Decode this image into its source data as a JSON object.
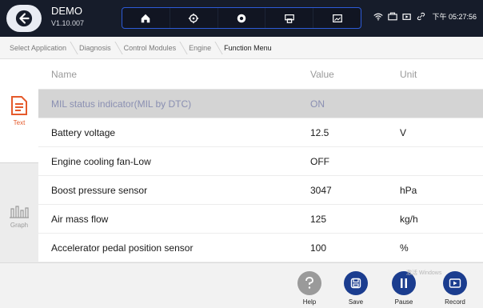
{
  "app": {
    "name": "DEMO",
    "version": "V1.10.007"
  },
  "nav_icons": [
    "home-icon",
    "settings-icon",
    "record-dot-icon",
    "print-icon",
    "screenshot-icon"
  ],
  "status": {
    "time": "下午 05:27:56",
    "icons": [
      "wifi-icon",
      "battery-case-icon",
      "video-icon",
      "link-icon"
    ]
  },
  "breadcrumb": [
    "Select Application",
    "Diagnosis",
    "Control Modules",
    "Engine",
    "Function Menu"
  ],
  "sidebar": {
    "text_label": "Text",
    "graph_label": "Graph"
  },
  "table": {
    "headers": {
      "name": "Name",
      "value": "Value",
      "unit": "Unit"
    },
    "rows": [
      {
        "name": "MIL status indicator(MIL by DTC)",
        "value": "ON",
        "unit": ""
      },
      {
        "name": "Battery voltage",
        "value": "12.5",
        "unit": "V"
      },
      {
        "name": "Engine cooling fan-Low",
        "value": "OFF",
        "unit": ""
      },
      {
        "name": "Boost pressure sensor",
        "value": "3047",
        "unit": "hPa"
      },
      {
        "name": "Air mass flow",
        "value": "125",
        "unit": "kg/h"
      },
      {
        "name": "Accelerator pedal position sensor",
        "value": "100",
        "unit": "%"
      }
    ]
  },
  "actions": {
    "help": "Help",
    "save": "Save",
    "pause": "Pause",
    "record": "Record"
  },
  "watermark": "激活 Windows",
  "colors": {
    "topbar": "#161c2a",
    "accent_blue": "#2d5bd7",
    "action_navy": "#1b3d8f",
    "highlight_row": "#d4d4d4",
    "text_icon_red": "#e55a2b"
  }
}
